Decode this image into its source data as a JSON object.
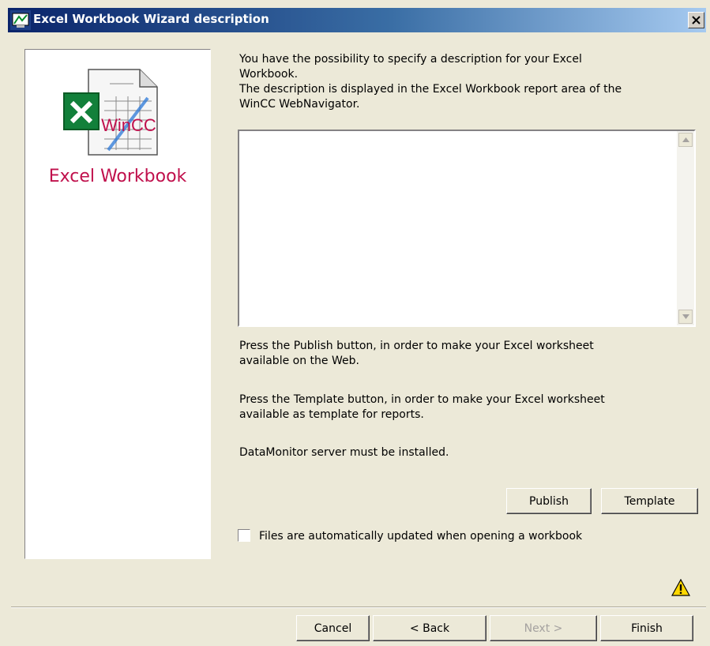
{
  "window": {
    "title": "Excel Workbook Wizard description",
    "close_label": "×"
  },
  "sidebar": {
    "title": "Excel Workbook",
    "logo_text": "WinCC"
  },
  "intro": {
    "line1": "You have the possibility to specify a description for your Excel",
    "line2": "Workbook.",
    "line3": "The description is displayed in the Excel Workbook report area of the",
    "line4": "WinCC WebNavigator."
  },
  "description": {
    "value": ""
  },
  "info": {
    "publish_line1": "Press the Publish button, in order to make your Excel worksheet",
    "publish_line2": "available  on the Web.",
    "template_line1": "Press the Template button, in order to make your Excel worksheet",
    "template_line2": "available as template for reports.",
    "server_note": "DataMonitor server must be installed."
  },
  "actions": {
    "publish": "Publish",
    "template": "Template"
  },
  "auto_update": {
    "label": "Files are automatically updated when opening a workbook",
    "checked": false
  },
  "footer": {
    "cancel": "Cancel",
    "back": "< Back",
    "next": "Next >",
    "finish": "Finish"
  },
  "icons": [
    "app-icon",
    "close-icon",
    "excel-workbook-icon",
    "scroll-up-icon",
    "scroll-down-icon",
    "warning-icon"
  ],
  "colors": {
    "title_gradient_start": "#0a246a",
    "title_gradient_end": "#a6caf0",
    "panel_title": "#c0104c",
    "dialog_bg": "#ece9d8"
  }
}
